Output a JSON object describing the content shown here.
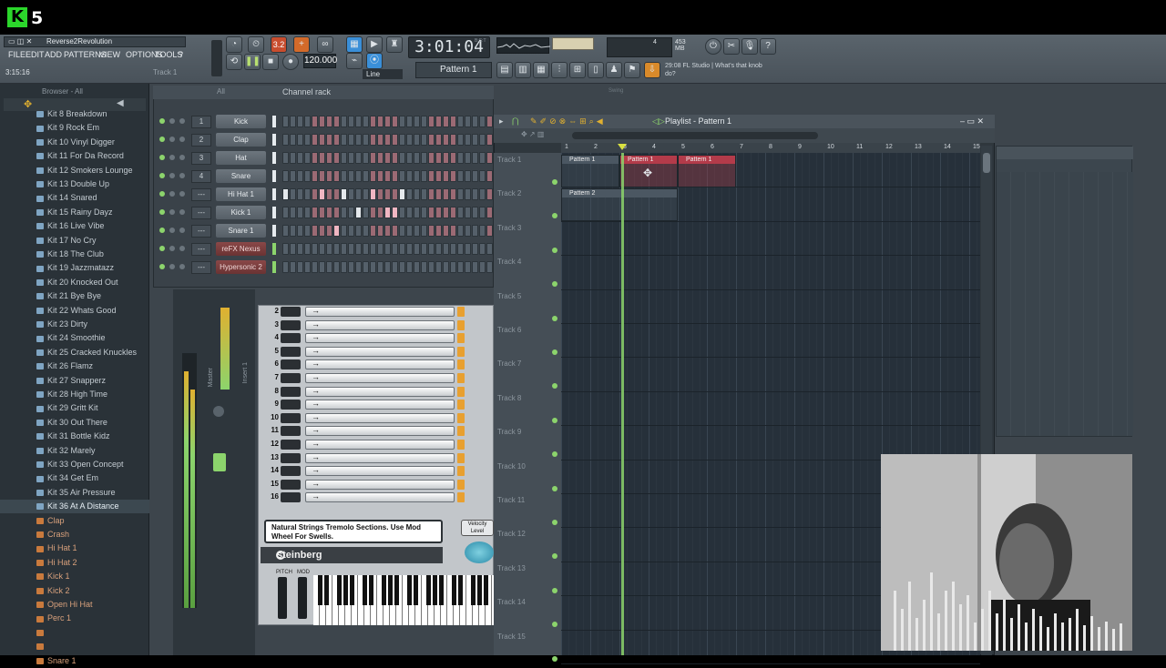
{
  "brand": {
    "logo_letter": "K",
    "logo_number": "5"
  },
  "app": {
    "project_name": "Reverse2Revolution",
    "song_time": "3:15:16",
    "track_hint": "Track 1",
    "time_display": "3:01:04",
    "time_suffix": "B:S:T",
    "tempo": "120.000",
    "pattern_selector": "Pattern 1",
    "snap": "Line",
    "memory": "453 MB",
    "cpu_poly": "4",
    "hint_time": "29:08",
    "hint_text": "FL Studio | What's that knob do?",
    "meter_value": "3.2"
  },
  "menu": [
    "FILE",
    "EDIT",
    "ADD",
    "PATTERNS",
    "VIEW",
    "OPTIONS",
    "TOOLS",
    "?"
  ],
  "browser": {
    "header": "Browser - All",
    "items": [
      {
        "label": "Kit 8 Breakdown",
        "type": "folder"
      },
      {
        "label": "Kit 9 Rock Em",
        "type": "folder"
      },
      {
        "label": "Kit 10 Vinyl Digger",
        "type": "folder"
      },
      {
        "label": "Kit 11 For Da Record",
        "type": "folder"
      },
      {
        "label": "Kit 12 Smokers Lounge",
        "type": "folder"
      },
      {
        "label": "Kit 13 Double Up",
        "type": "folder"
      },
      {
        "label": "Kit 14 Snared",
        "type": "folder"
      },
      {
        "label": "Kit 15 Rainy Dayz",
        "type": "folder"
      },
      {
        "label": "Kit 16 Live Vibe",
        "type": "folder"
      },
      {
        "label": "Kit 17 No Cry",
        "type": "folder"
      },
      {
        "label": "Kit 18 The Club",
        "type": "folder"
      },
      {
        "label": "Kit 19 Jazzmatazz",
        "type": "folder"
      },
      {
        "label": "Kit 20 Knocked Out",
        "type": "folder"
      },
      {
        "label": "Kit 21 Bye Bye",
        "type": "folder"
      },
      {
        "label": "Kit 22 Whats Good",
        "type": "folder"
      },
      {
        "label": "Kit 23 Dirty",
        "type": "folder"
      },
      {
        "label": "Kit 24 Smoothie",
        "type": "folder"
      },
      {
        "label": "Kit 25 Cracked Knuckles",
        "type": "folder"
      },
      {
        "label": "Kit 26 Flamz",
        "type": "folder"
      },
      {
        "label": "Kit 27 Snapperz",
        "type": "folder"
      },
      {
        "label": "Kit 28 High Time",
        "type": "folder"
      },
      {
        "label": "Kit 29 Gritt Kit",
        "type": "folder"
      },
      {
        "label": "Kit 30 Out There",
        "type": "folder"
      },
      {
        "label": "Kit 31 Bottle Kidz",
        "type": "folder"
      },
      {
        "label": "Kit 32 Marely",
        "type": "folder"
      },
      {
        "label": "Kit 33 Open Concept",
        "type": "folder"
      },
      {
        "label": "Kit 34 Get Em",
        "type": "folder"
      },
      {
        "label": "Kit 35 Air Pressure",
        "type": "folder"
      },
      {
        "label": "Kit 36 At A Distance",
        "type": "folder",
        "selected": true
      },
      {
        "label": "Clap",
        "type": "file"
      },
      {
        "label": "Crash",
        "type": "file"
      },
      {
        "label": "Hi Hat 1",
        "type": "file"
      },
      {
        "label": "Hi Hat 2",
        "type": "file"
      },
      {
        "label": "Kick 1",
        "type": "file"
      },
      {
        "label": "Kick 2",
        "type": "file"
      },
      {
        "label": "Open Hi Hat",
        "type": "file"
      },
      {
        "label": "Perc 1",
        "type": "file"
      },
      {
        "label": "",
        "type": "file"
      },
      {
        "label": "",
        "type": "file"
      },
      {
        "label": "Snare 1",
        "type": "file"
      }
    ]
  },
  "channel_rack": {
    "title": "Channel rack",
    "filter": "All",
    "swing_label": "Swing",
    "channels": [
      {
        "num": "1",
        "name": "Kick",
        "style": "normal"
      },
      {
        "num": "2",
        "name": "Clap",
        "style": "normal"
      },
      {
        "num": "3",
        "name": "Hat",
        "style": "normal"
      },
      {
        "num": "4",
        "name": "Snare",
        "style": "normal"
      },
      {
        "num": "---",
        "name": "Hi Hat 1",
        "style": "normal"
      },
      {
        "num": "---",
        "name": "Kick 1",
        "style": "normal"
      },
      {
        "num": "---",
        "name": "Snare 1",
        "style": "normal"
      },
      {
        "num": "---",
        "name": "reFX Nexus",
        "style": "red"
      },
      {
        "num": "---",
        "name": "Hypersonic 2",
        "style": "red"
      }
    ]
  },
  "playlist": {
    "title": "Playlist - Pattern 1",
    "ruler": [
      "1",
      "2",
      "3",
      "4",
      "5",
      "6",
      "7",
      "8",
      "9",
      "10",
      "11",
      "12",
      "13",
      "14",
      "15"
    ],
    "tracks": [
      "Track 1",
      "Track 2",
      "Track 3",
      "Track 4",
      "Track 5",
      "Track 6",
      "Track 7",
      "Track 8",
      "Track 9",
      "Track 10",
      "Track 11",
      "Track 12",
      "Track 13",
      "Track 14",
      "Track 15"
    ],
    "clips": [
      {
        "label": "Pattern 1",
        "track": 0,
        "bar_start": 1,
        "bar_len": 2,
        "color": "#4b5762"
      },
      {
        "label": "Pattern 1",
        "track": 0,
        "bar_start": 3,
        "bar_len": 2,
        "color": "#b33b4a"
      },
      {
        "label": "Pattern 1",
        "track": 0,
        "bar_start": 5,
        "bar_len": 2,
        "color": "#b33b4a"
      },
      {
        "label": "Pattern 2",
        "track": 1,
        "bar_start": 1,
        "bar_len": 4,
        "color": "#4b5762"
      }
    ],
    "playhead_bar": 3
  },
  "plugin": {
    "rows": [
      "2",
      "3",
      "4",
      "5",
      "6",
      "7",
      "8",
      "9",
      "10",
      "11",
      "12",
      "13",
      "14",
      "15",
      "16"
    ],
    "description": "Natural Strings Tremolo Sections. Use Mod Wheel For Swells.",
    "brand": "steinberg",
    "velocity_label": "Velocity Level",
    "pitch_label": "PITCH",
    "mod_label": "MOD"
  },
  "mixer": {
    "insert_label": "Insert 1",
    "master_label": "Master"
  },
  "colors": {
    "accent_green": "#8cd46c",
    "clip_red": "#b33b4a",
    "clip_grey": "#4b5762"
  }
}
